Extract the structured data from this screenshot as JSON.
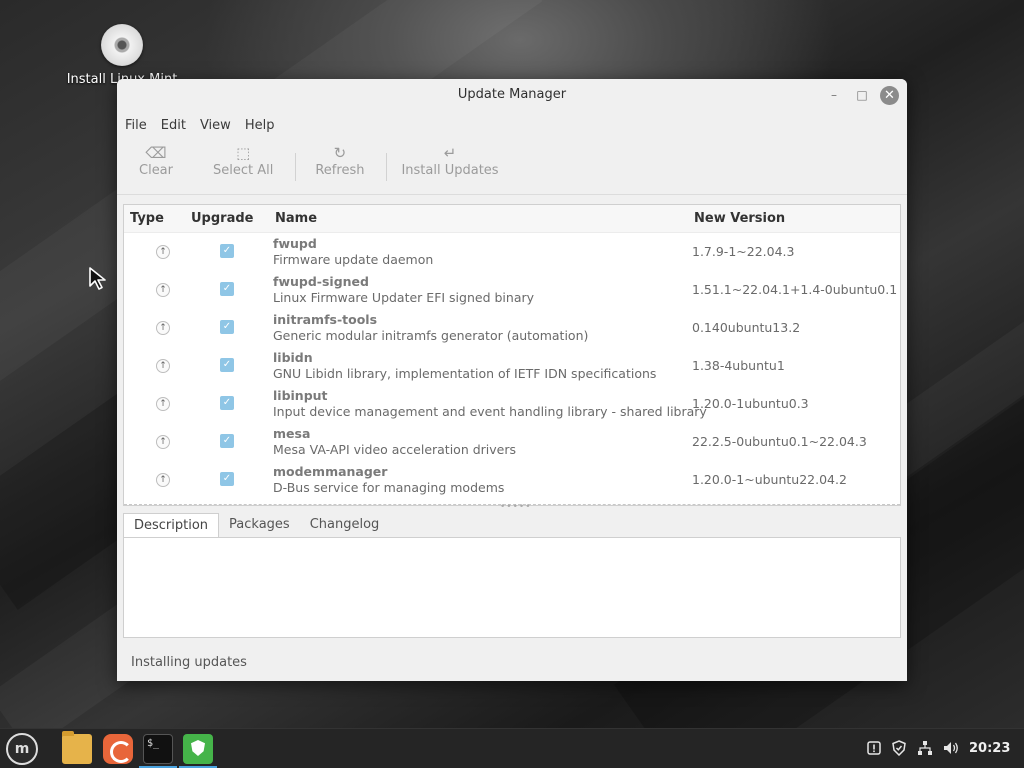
{
  "desktop": {
    "icon_label": "Install Linux Mint"
  },
  "window": {
    "title": "Update Manager",
    "controls": {
      "minimize": "–",
      "maximize": "□",
      "close": "✕"
    },
    "menu": [
      "File",
      "Edit",
      "View",
      "Help"
    ],
    "toolbar": [
      {
        "icon": "backspace-icon",
        "glyph": "⌫",
        "label": "Clear"
      },
      {
        "icon": "select-all-icon",
        "glyph": "⬚",
        "label": "Select All"
      },
      {
        "icon": "refresh-icon",
        "glyph": "↻",
        "label": "Refresh"
      },
      {
        "icon": "install-icon",
        "glyph": "↵",
        "label": "Install Updates"
      }
    ],
    "columns": {
      "type": "Type",
      "upgrade": "Upgrade",
      "name": "Name",
      "version": "New Version"
    },
    "updates": [
      {
        "name": "fwupd",
        "description": "Firmware update daemon",
        "version": "1.7.9-1~22.04.3",
        "checked": true
      },
      {
        "name": "fwupd-signed",
        "description": "Linux Firmware Updater EFI signed binary",
        "version": "1.51.1~22.04.1+1.4-0ubuntu0.1",
        "checked": true
      },
      {
        "name": "initramfs-tools",
        "description": "Generic modular initramfs generator (automation)",
        "version": "0.140ubuntu13.2",
        "checked": true
      },
      {
        "name": "libidn",
        "description": "GNU Libidn library, implementation of IETF IDN specifications",
        "version": "1.38-4ubuntu1",
        "checked": true
      },
      {
        "name": "libinput",
        "description": "Input device management and event handling library - shared library",
        "version": "1.20.0-1ubuntu0.3",
        "checked": true
      },
      {
        "name": "mesa",
        "description": "Mesa VA-API video acceleration drivers",
        "version": "22.2.5-0ubuntu0.1~22.04.3",
        "checked": true
      },
      {
        "name": "modemmanager",
        "description": "D-Bus service for managing modems",
        "version": "1.20.0-1~ubuntu22.04.2",
        "checked": true
      }
    ],
    "tabs": [
      "Description",
      "Packages",
      "Changelog"
    ],
    "active_tab": "Description",
    "status": "Installing updates"
  },
  "taskbar": {
    "clock": "20:23",
    "accent_color": "#4aa3df"
  }
}
